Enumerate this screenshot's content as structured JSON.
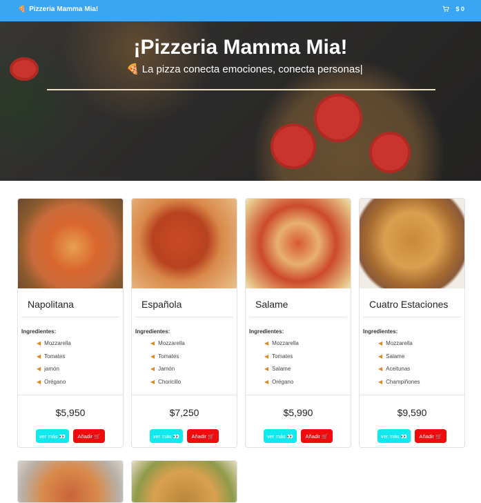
{
  "navbar": {
    "brand": "Pizzeria Mamma Mia!",
    "cart_total": "$ 0",
    "brand_icon": "pizza-icon",
    "cart_icon": "cart-icon",
    "color": "#3aa5f2"
  },
  "hero": {
    "title": "¡Pizzeria Mamma Mia!",
    "subtitle": "La pizza conecta emociones, conecta personas|"
  },
  "labels": {
    "ingredients": "Ingredientes:",
    "see_more": "ver más 👀",
    "add": "Añadir 🛒"
  },
  "pizzas": [
    {
      "name": "Napolitana",
      "price": "$5,950",
      "ingredients": [
        "Mozzarella",
        "Tomates",
        "jamón",
        "Orégano"
      ]
    },
    {
      "name": "Española",
      "price": "$7,250",
      "ingredients": [
        "Mozzarella",
        "Tomates",
        "Jamón",
        "Choricillo"
      ]
    },
    {
      "name": "Salame",
      "price": "$5,990",
      "ingredients": [
        "Mozzarella",
        "Tomates",
        "Salame",
        "Orégano"
      ]
    },
    {
      "name": "Cuatro Estaciones",
      "price": "$9,590",
      "ingredients": [
        "Mozzarella",
        "Salame",
        "Aceitunas",
        "Champiñones"
      ]
    }
  ],
  "colors": {
    "see_more": "#11e9ef",
    "add": "#ef0c0c"
  }
}
